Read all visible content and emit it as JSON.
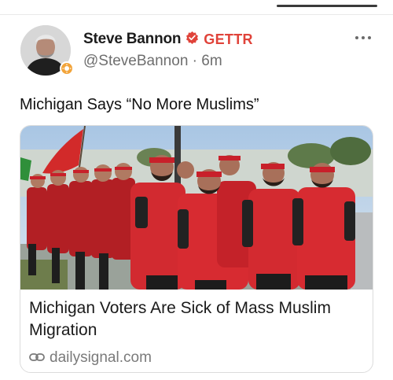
{
  "post": {
    "author_name": "Steve Bannon",
    "platform_mark": "GETTR",
    "handle": "@SteveBannon",
    "separator": "·",
    "time_ago": "6m",
    "text": "Michigan Says “No More Muslims”"
  },
  "card": {
    "title": "Michigan Voters Are Sick of Mass Muslim Migration",
    "domain": "dailysignal.com"
  },
  "icons": {
    "verified": "verified-badge-icon",
    "avatar_badge": "sun-badge-icon",
    "more": "more-options-icon",
    "link": "link-icon"
  },
  "colors": {
    "brand_red": "#e0433a",
    "badge_orange": "#f2a43a",
    "muted_text": "#6e6e6e"
  }
}
